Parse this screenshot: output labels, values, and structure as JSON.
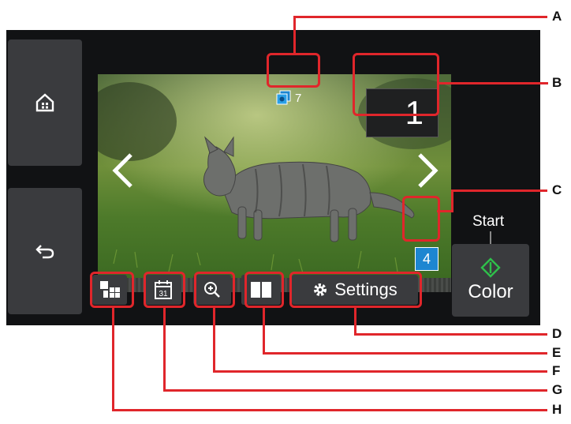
{
  "preview": {
    "sheet_count": "7",
    "copies": "1",
    "photo_number": "4"
  },
  "toolbar": {
    "settings_label": "Settings"
  },
  "start": {
    "label": "Start",
    "color_label": "Color",
    "accent": "#2fbf4a"
  },
  "callouts": [
    "A",
    "B",
    "C",
    "D",
    "E",
    "F",
    "G",
    "H"
  ],
  "colors": {
    "highlight": "#e0262b",
    "panel": "#111214",
    "button": "#3a3b3e"
  }
}
